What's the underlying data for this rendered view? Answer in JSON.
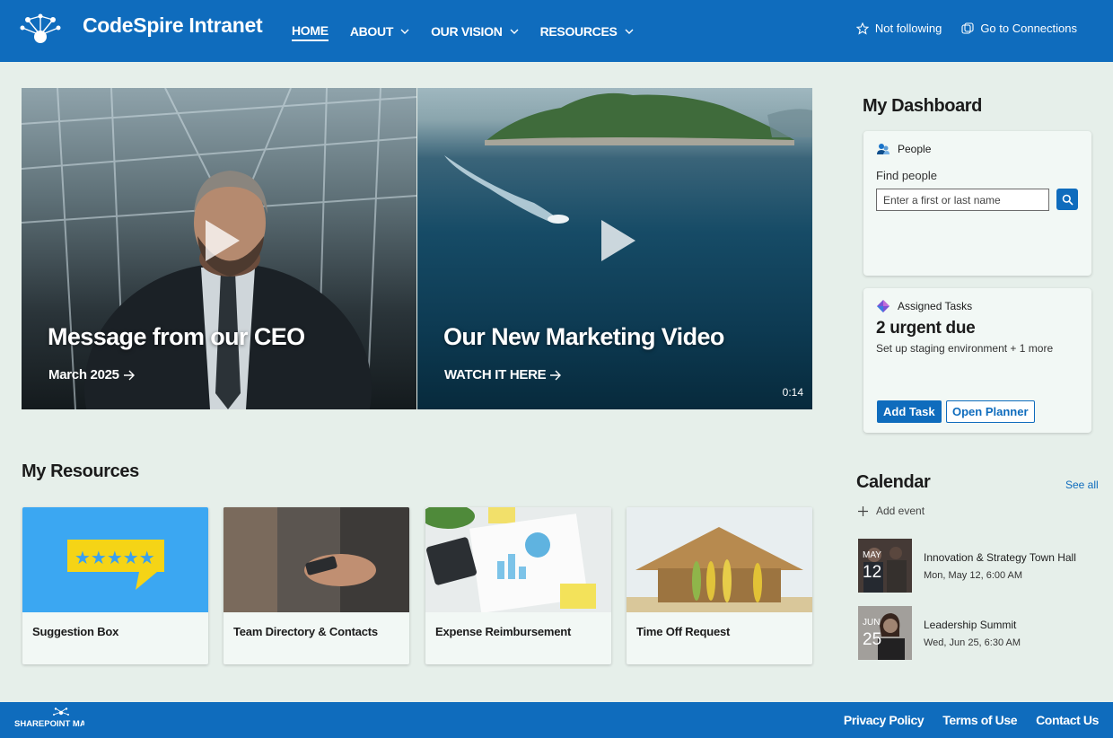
{
  "site": {
    "title": "CodeSpire Intranet"
  },
  "nav": [
    {
      "label": "HOME",
      "active": true,
      "dropdown": false
    },
    {
      "label": "ABOUT",
      "active": false,
      "dropdown": true
    },
    {
      "label": "OUR VISION",
      "active": false,
      "dropdown": true
    },
    {
      "label": "RESOURCES",
      "active": false,
      "dropdown": true
    }
  ],
  "header_actions": {
    "follow_label": "Not following",
    "connections_label": "Go to Connections"
  },
  "hero": [
    {
      "title": "Message from our CEO",
      "link": "March 2025"
    },
    {
      "title": "Our New Marketing Video",
      "link": "WATCH IT HERE",
      "duration": "0:14"
    }
  ],
  "dashboard": {
    "title": "My Dashboard",
    "people": {
      "header": "People",
      "find_label": "Find people",
      "placeholder": "Enter a first or last name"
    },
    "tasks": {
      "header": "Assigned Tasks",
      "urgent": "2 urgent due",
      "subtitle": "Set up staging environment + 1 more",
      "add_task": "Add Task",
      "open_planner": "Open Planner"
    }
  },
  "resources": {
    "title": "My Resources",
    "items": [
      {
        "label": "Suggestion Box"
      },
      {
        "label": "Team Directory & Contacts"
      },
      {
        "label": "Expense Reimbursement"
      },
      {
        "label": "Time Off Request"
      }
    ]
  },
  "calendar": {
    "title": "Calendar",
    "see_all": "See all",
    "add_event": "Add event",
    "events": [
      {
        "month": "MAY",
        "day": "12",
        "title": "Innovation & Strategy Town Hall",
        "time": "Mon, May 12, 6:00 AM"
      },
      {
        "month": "JUN",
        "day": "25",
        "title": "Leadership Summit",
        "time": "Wed, Jun 25, 6:30 AM"
      }
    ]
  },
  "footer": {
    "links": [
      "Privacy Policy",
      "Terms of Use",
      "Contact Us"
    ],
    "logo_text": "SHAREPOINT MAVEN"
  },
  "colors": {
    "brand": "#0f6cbd",
    "background": "#e6efea",
    "card": "#f2f8f5"
  }
}
